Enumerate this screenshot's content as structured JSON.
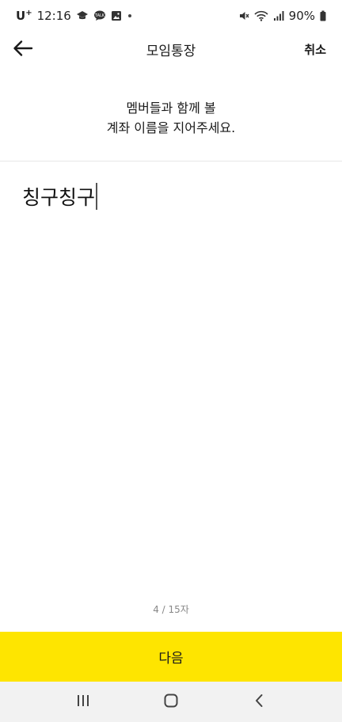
{
  "status_bar": {
    "carrier": "U",
    "carrier_sup": "+",
    "time": "12:16",
    "battery": "90%",
    "icons": [
      "graduation-cap-icon",
      "talk-bubble-icon",
      "image-icon",
      "notification-dot",
      "mute-icon",
      "wifi-icon",
      "signal-icon",
      "battery-icon"
    ]
  },
  "app_bar": {
    "title": "모임통장",
    "cancel_label": "취소",
    "back_icon": "arrow-left-icon"
  },
  "instruction": {
    "line1": "멤버들과 함께 볼",
    "line2": "계좌 이름을 지어주세요."
  },
  "name_input": {
    "value": "칭구칭구"
  },
  "counter": {
    "text": "4 / 15자"
  },
  "next_button": {
    "label": "다음",
    "color": "#fee500"
  },
  "nav_bar": {
    "icons": [
      "recent-apps-icon",
      "home-icon",
      "back-icon"
    ]
  }
}
